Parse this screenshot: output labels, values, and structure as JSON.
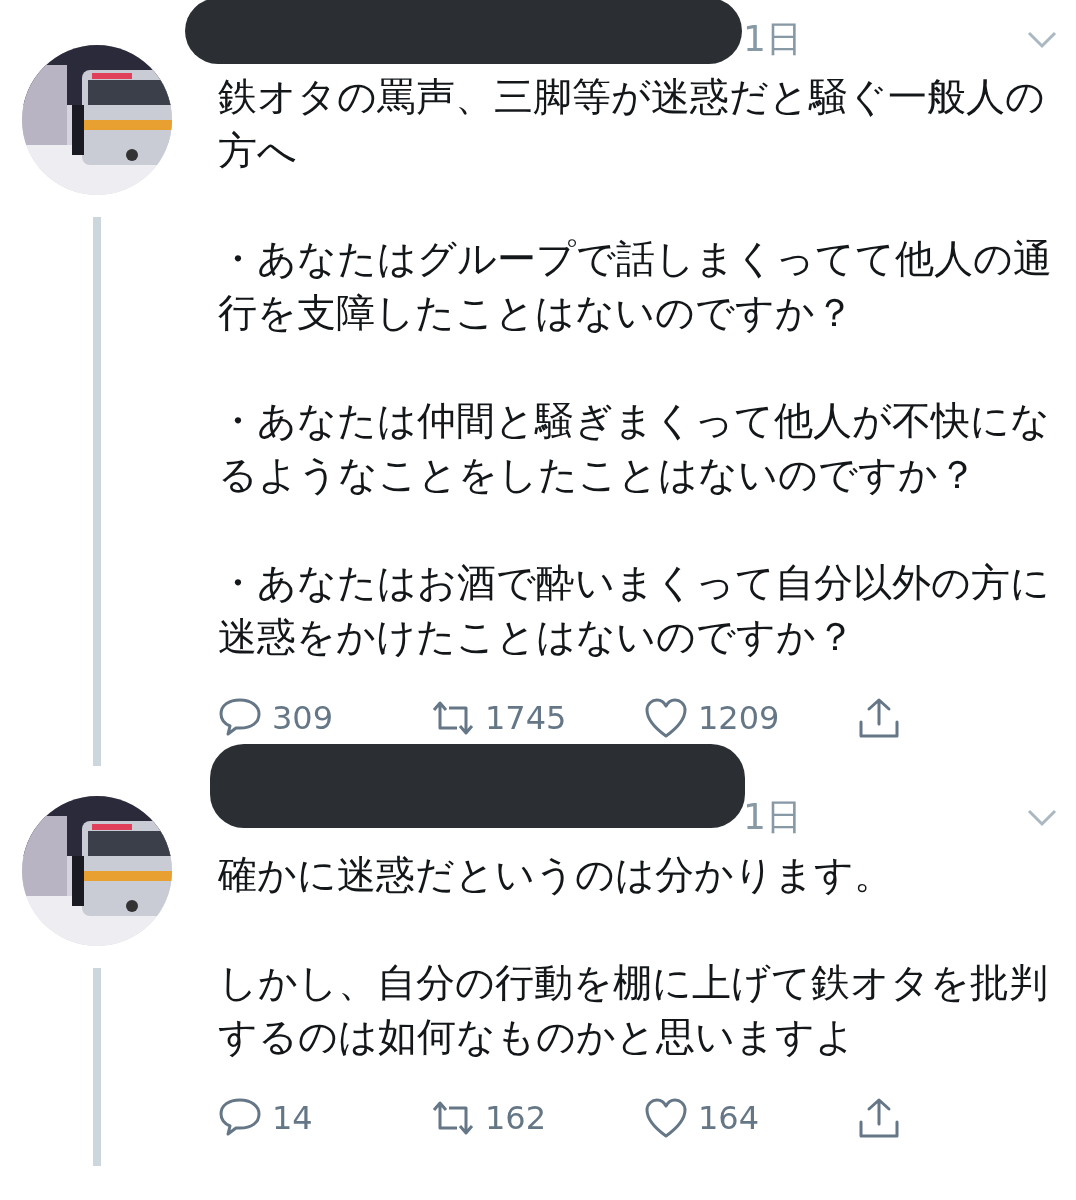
{
  "tweets": [
    {
      "time": "1日",
      "paragraphs": [
        "鉄オタの罵声、三脚等が迷惑だと騒ぐ一般人の方へ",
        "・あなたはグループで話しまくってて他人の通行を支障したことはないのですか？",
        "・あなたは仲間と騒ぎまくって他人が不快になるようなことをしたことはないのですか？",
        "・あなたはお酒で酔いまくって自分以外の方に迷惑をかけたことはないのですか？"
      ],
      "replies": "309",
      "retweets": "1745",
      "likes": "1209"
    },
    {
      "time": "1日",
      "paragraphs": [
        "確かに迷惑だというのは分かります。",
        "しかし、自分の行動を棚に上げて鉄オタを批判するのは如何なものかと思いますよ"
      ],
      "replies": "14",
      "retweets": "162",
      "likes": "164"
    }
  ]
}
